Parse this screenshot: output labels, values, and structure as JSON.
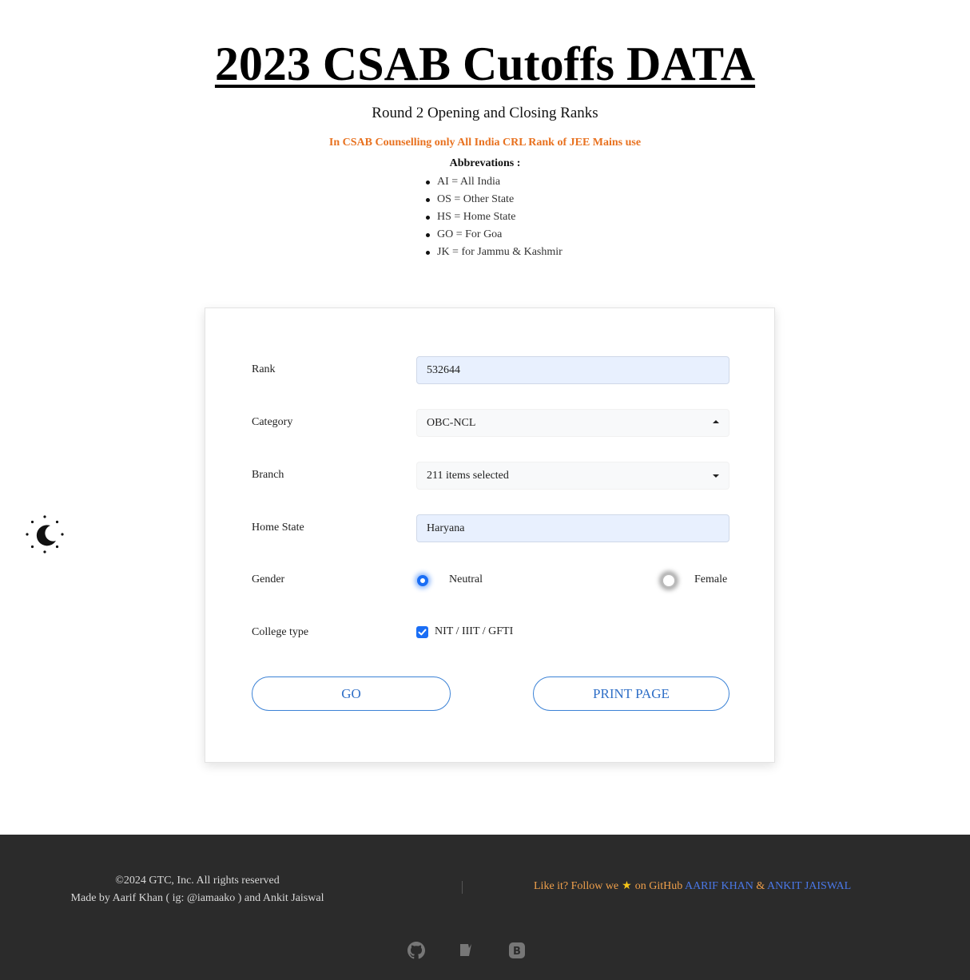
{
  "header": {
    "title": "2023 CSAB Cutoffs DATA",
    "subtitle": "Round 2 Opening and Closing Ranks",
    "note": "In CSAB Counselling only All India CRL Rank of JEE Mains use",
    "abbreviations_title": "Abbrevations :",
    "abbreviations": [
      "AI = All India",
      "OS = Other State",
      "HS = Home State",
      "GO = For Goa",
      "JK = for Jammu & Kashmir"
    ]
  },
  "theme_toggle": {
    "icon": "moon-sun-icon"
  },
  "form": {
    "rank": {
      "label": "Rank",
      "value": "532644"
    },
    "category": {
      "label": "Category",
      "value": "OBC-NCL",
      "state": "open"
    },
    "branch": {
      "label": "Branch",
      "value": "211 items selected",
      "state": "closed"
    },
    "home_state": {
      "label": "Home State",
      "value": "Haryana"
    },
    "gender": {
      "label": "Gender",
      "options": [
        {
          "label": "Neutral",
          "selected": true
        },
        {
          "label": "Female",
          "selected": false
        }
      ]
    },
    "college_type": {
      "label": "College type",
      "option": "NIT / IIIT / GFTI",
      "checked": true
    },
    "go_label": "GO",
    "print_label": "PRINT PAGE"
  },
  "footer": {
    "copyright": "©2024 GTC, Inc. All rights reserved",
    "credit": "Made by Aarif Khan ( ig: @iamaako ) and Ankit Jaiswal",
    "follow_prefix": "Like it? Follow we",
    "follow_suffix": "on GitHub",
    "author1": "AARIF KHAN",
    "separator": "&",
    "author2": "ANKIT JAISWAL",
    "social_icons": [
      "github-icon",
      "notion-icon",
      "bootstrap-icon"
    ]
  },
  "colors": {
    "accent": "#1a6ef5",
    "note": "#e8711f",
    "footer_bg": "#2b2b2b",
    "link": "#4a78e8"
  }
}
